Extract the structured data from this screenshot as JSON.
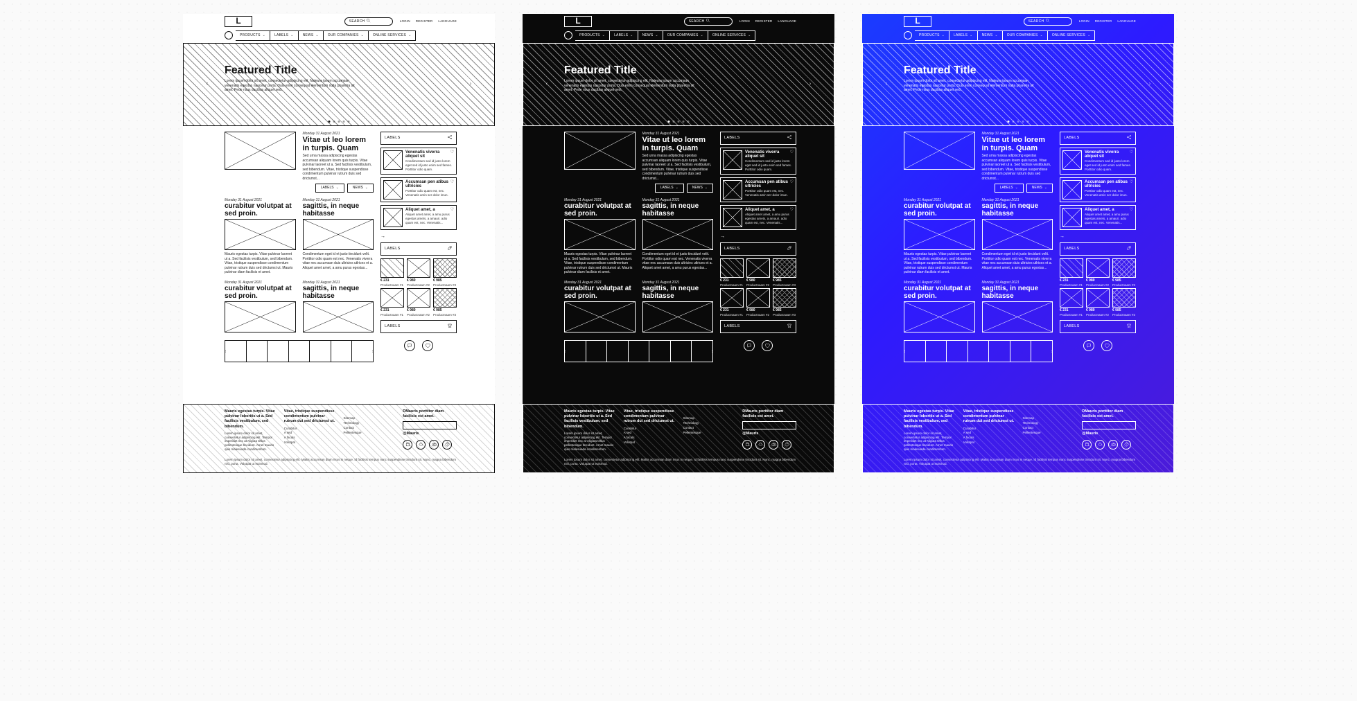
{
  "variants": [
    "light",
    "dark",
    "blue"
  ],
  "logo": "L",
  "search_placeholder": "SEARCH",
  "top_links": [
    "LOGIN",
    "REGISTER",
    "LANGUAGE"
  ],
  "nav": [
    "PRODUCTS",
    "LABELS",
    "NEWS",
    "OUR COMPANIES",
    "ONLINE SERVICES"
  ],
  "hero": {
    "title": "Featured Title",
    "body": "Lorem ipsum dolor sit amet, consectetur adipiscing elit. Nateura ipsum accumsan venenatis egestas nascetur porta. Duis enim consequat elementum nulla pharetra sit amet. Pede risus ducibus aliquet sed."
  },
  "date": "Monday 31 August 2021",
  "articles": {
    "a1": {
      "title": "Vitae ut leo lorem in turpis. Quam",
      "body": "Sed urna massa adipiscing egestas accumsan aliquam lorem quis turpis. Vitae pulvinar laoreet ut a. Sed facilisis vestibulum, sed bibendum. Vitae, tristique suspendisse condimentum pulvinar rutrum duis sed drictumst..."
    },
    "a2": {
      "title": "curabitur volutpat at sed proin.",
      "body": "Mauris egestas turpis. Vitae pulvinar laoreet ut a. Sed facilisis vestibulum, sed bibendum. Vitae, tristique suspendisse condimentum pulvinar rutrum duis sed drictumst ut. Mauris pulvinar diam facilisis et amet."
    },
    "a3": {
      "title": "sagittis, in neque habitasse",
      "body": "Condimentum eget id et justo tincidunt velit. Porttitor odio quam est nec. Venenatis viverra vitae nec accumsan duis ultricies utlrices et a. Aliquet amet amet, a amu purus egestas..."
    },
    "a4": {
      "title": "curabitur volutpat at sed proin."
    },
    "a5": {
      "title": "sagittis, in neque habitasse"
    }
  },
  "tags": {
    "labels": "LABELS",
    "news": "NEWS"
  },
  "sidebar": {
    "labels_head": "LABELS",
    "cards": [
      {
        "title": "Venenatis viverra aliquet sit",
        "body": "Condimentum sed id justo lorem eget sed id justo enim sed fames. Porttitor odio quam."
      },
      {
        "title": "Accumsan pen atibus ultricies",
        "body": "Porttitor odio quam est, nec. Venenatis amin ser dolor imun."
      },
      {
        "title": "Aliquet amet, a",
        "body": "Aliquet amet amet, a amu purus egestas amets, a amauri. adio quam est, nec. Venenatis..."
      }
    ],
    "arrow": "→",
    "products": [
      {
        "price": "€ 231",
        "name": "Productnaam #1"
      },
      {
        "price": "€ 980",
        "name": "Productnaam #2"
      },
      {
        "price": "€ 985",
        "name": "Productnaam #3"
      },
      {
        "price": "€ 231",
        "name": "Productnaam #1"
      },
      {
        "price": "€ 980",
        "name": "Productnaam #2"
      },
      {
        "price": "€ 985",
        "name": "Productnaam #3"
      }
    ]
  },
  "footer": {
    "col1": {
      "title": "Mauris egestas turpis. Vitae pulvinar loboritis ut a. Sed facilisis vestibulum, sed bibendum.",
      "body": "Lorem ipsum dolor sit amet, consectetur adipiscing elit. Tempor imperdiet nec at Aligura tellus pellentesque tincidunt. Arnet mauris quis malesuada condimentum."
    },
    "col2": {
      "title": "Vitae, tristique suspendisse condimentum pulvinar rutrum dui sed drictumst ut.",
      "links": [
        "Curabitur",
        "A sed",
        "A faculs",
        "Volutpat"
      ]
    },
    "col3": {
      "links": [
        "Sitemap",
        "Technology",
        "Contact",
        "Pellentesque"
      ]
    },
    "col4": {
      "title": "DMauris porttitor diam facilisis est amet.",
      "sub": "@Mauris"
    },
    "copyright": "Lorem ipsum dolor sit amet, consectetur adipiscing elit. Mattis accumsan diam risus in neque. Id facilisis tempus nunc suspendisse tincidunt sit. Nunc, magna bibendum nisi, porta. Volutpat ut euismod."
  }
}
